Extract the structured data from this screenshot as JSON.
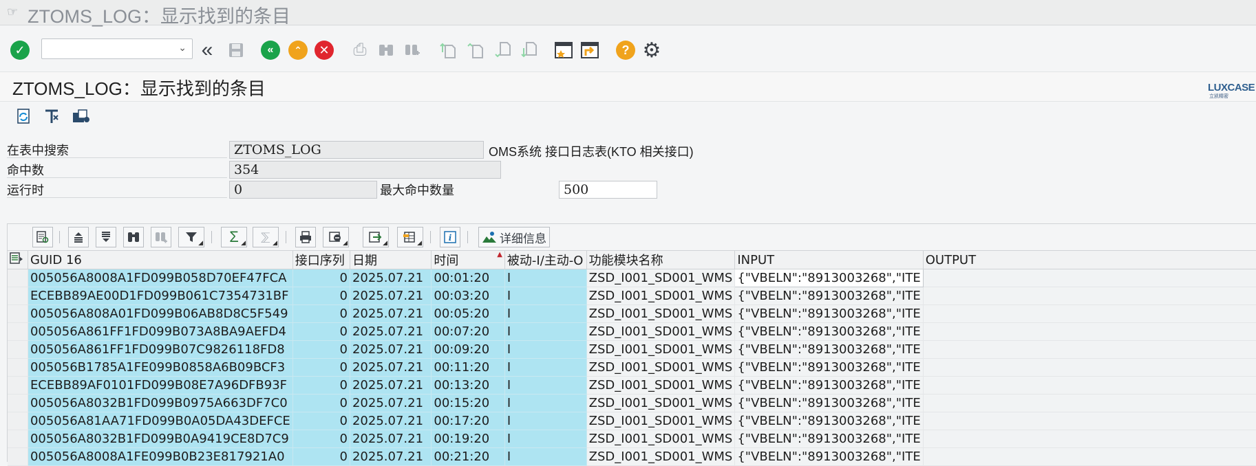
{
  "window": {
    "title": "ZTOMS_LOG：显示找到的条目"
  },
  "toolbar": {
    "command_field": {
      "value": "",
      "placeholder": ""
    },
    "icons": [
      "enter-check-icon",
      "back-double-chevron-icon",
      "save-disk-icon",
      "back-green-icon",
      "exit-up-icon",
      "cancel-red-icon",
      "print-icon",
      "find-icon",
      "find-next-icon",
      "first-page-icon",
      "previous-page-icon",
      "next-page-icon",
      "last-page-icon",
      "create-session-icon",
      "generate-shortcut-icon",
      "help-icon",
      "settings-gear-icon"
    ]
  },
  "screen": {
    "title": "ZTOMS_LOG：显示找到的条目",
    "logo_text": "LUXCASE",
    "logo_sub": "立凯精密"
  },
  "form": {
    "table_label": "在表中搜索",
    "table_value": "ZTOMS_LOG",
    "table_desc": "OMS系统 接口日志表(KTO 相关接口)",
    "hits_label": "命中数",
    "hits_value": "354",
    "runtime_label": "运行时",
    "runtime_value": "0",
    "max_hits_label": "最大命中数量",
    "max_hits_value": "500"
  },
  "grid_toolbar": {
    "details_label": "详细信息"
  },
  "table": {
    "columns": [
      "GUID 16",
      "接口序列",
      "日期",
      "时间",
      "被动-I/主动-O",
      "功能模块名称",
      "INPUT",
      "OUTPUT"
    ],
    "rows": [
      [
        "005056A8008A1FD099B058D70EF47FCA",
        "0",
        "2025.07.21",
        "00:01:20",
        "I",
        "ZSD_I001_SD001_WMS",
        "{\"VBELN\":\"8913003268\",\"ITE",
        ""
      ],
      [
        "ECEBB89AE00D1FD099B061C7354731BF",
        "0",
        "2025.07.21",
        "00:03:20",
        "I",
        "ZSD_I001_SD001_WMS",
        "{\"VBELN\":\"8913003268\",\"ITE",
        ""
      ],
      [
        "005056A808A01FD099B06AB8D8C5F549",
        "0",
        "2025.07.21",
        "00:05:20",
        "I",
        "ZSD_I001_SD001_WMS",
        "{\"VBELN\":\"8913003268\",\"ITE",
        ""
      ],
      [
        "005056A861FF1FD099B073A8BA9AEFD4",
        "0",
        "2025.07.21",
        "00:07:20",
        "I",
        "ZSD_I001_SD001_WMS",
        "{\"VBELN\":\"8913003268\",\"ITE",
        ""
      ],
      [
        "005056A861FF1FD099B07C9826118FD8",
        "0",
        "2025.07.21",
        "00:09:20",
        "I",
        "ZSD_I001_SD001_WMS",
        "{\"VBELN\":\"8913003268\",\"ITE",
        ""
      ],
      [
        "005056B1785A1FE099B0858A6B09BCF3",
        "0",
        "2025.07.21",
        "00:11:20",
        "I",
        "ZSD_I001_SD001_WMS",
        "{\"VBELN\":\"8913003268\",\"ITE",
        ""
      ],
      [
        "ECEBB89AF0101FD099B08E7A96DFB93F",
        "0",
        "2025.07.21",
        "00:13:20",
        "I",
        "ZSD_I001_SD001_WMS",
        "{\"VBELN\":\"8913003268\",\"ITE",
        ""
      ],
      [
        "005056A8032B1FD099B0975A663DF7C0",
        "0",
        "2025.07.21",
        "00:15:20",
        "I",
        "ZSD_I001_SD001_WMS",
        "{\"VBELN\":\"8913003268\",\"ITE",
        ""
      ],
      [
        "005056A81AA71FD099B0A05DA43DEFCE",
        "0",
        "2025.07.21",
        "00:17:20",
        "I",
        "ZSD_I001_SD001_WMS",
        "{\"VBELN\":\"8913003268\",\"ITE",
        ""
      ],
      [
        "005056A8032B1FD099B0A9419CE8D7C9",
        "0",
        "2025.07.21",
        "00:19:20",
        "I",
        "ZSD_I001_SD001_WMS",
        "{\"VBELN\":\"8913003268\",\"ITE",
        ""
      ],
      [
        "005056A8008A1FE099B0B23E817921A0",
        "0",
        "2025.07.21",
        "00:21:20",
        "I",
        "ZSD_I001_SD001_WMS",
        "{\"VBELN\":\"8913003268\",\"ITE",
        ""
      ]
    ]
  },
  "colors": {
    "selection": "#aee4f2",
    "green": "#1aa34a",
    "orange": "#f0a31c",
    "red": "#e0262e"
  }
}
